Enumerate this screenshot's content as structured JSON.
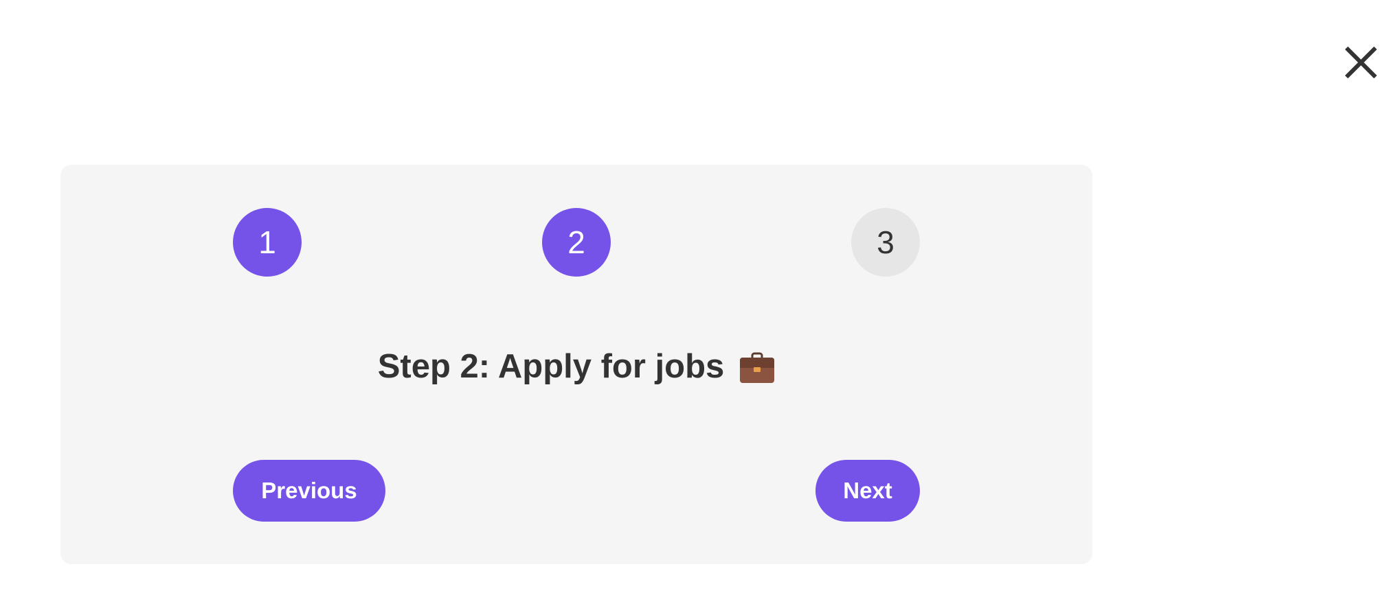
{
  "close": {
    "icon": "close-icon"
  },
  "steps": [
    {
      "label": "1",
      "state": "complete"
    },
    {
      "label": "2",
      "state": "current"
    },
    {
      "label": "3",
      "state": "upcoming"
    }
  ],
  "content": {
    "heading": "Step 2: Apply for jobs",
    "heading_icon": "briefcase-icon"
  },
  "nav": {
    "previous_label": "Previous",
    "next_label": "Next"
  },
  "colors": {
    "accent": "#7553e8",
    "inactive_step": "#e6e6e6",
    "card_background": "#f5f5f6",
    "text": "#333333"
  }
}
